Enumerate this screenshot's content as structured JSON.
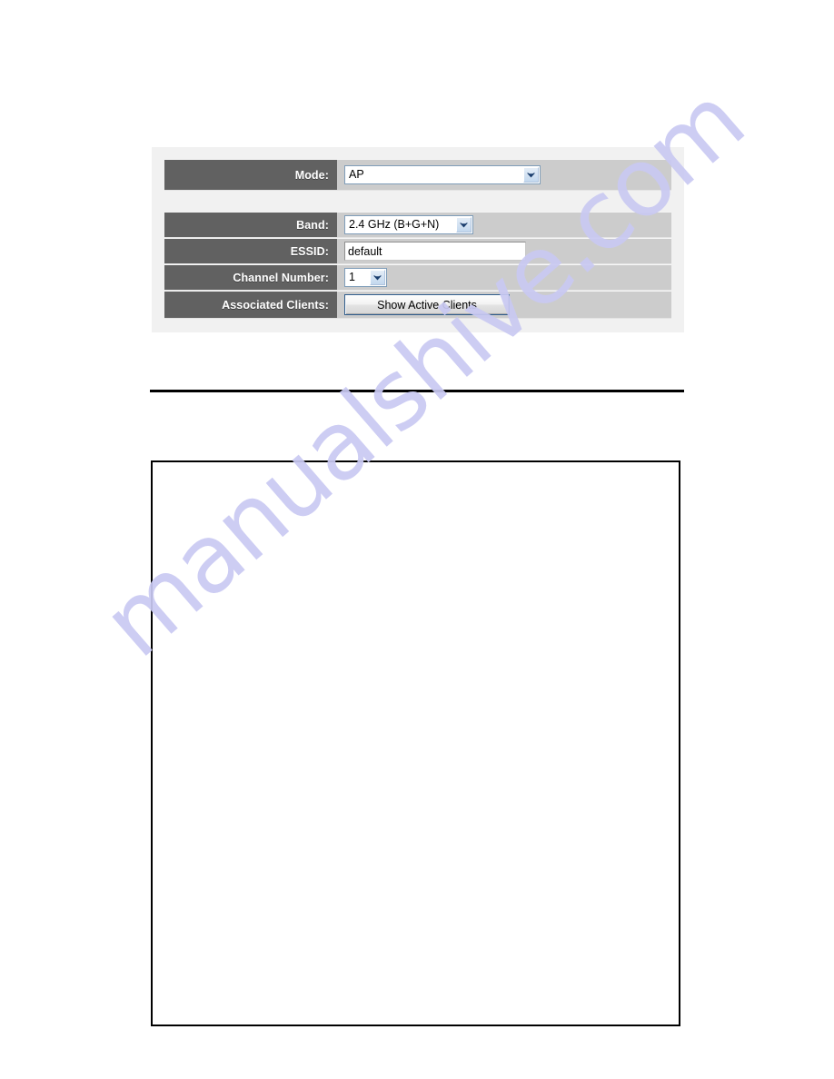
{
  "page": {
    "watermark": "manualshive.com",
    "watermark_color": "#c9c9f2"
  },
  "settings_panel": {
    "label_bg": "#616161",
    "value_bg": "#cccccc",
    "panel_bg": "#f1f1f1",
    "rows": [
      {
        "name": "mode",
        "label": "Mode:",
        "control": "select",
        "value": "AP"
      },
      {
        "name": "band",
        "label": "Band:",
        "control": "select",
        "value": "2.4 GHz (B+G+N)"
      },
      {
        "name": "essid",
        "label": "ESSID:",
        "control": "text",
        "value": "default",
        "placeholder": ""
      },
      {
        "name": "channel-number",
        "label": "Channel Number:",
        "control": "select",
        "value": "1"
      },
      {
        "name": "associated-clients",
        "label": "Associated Clients:",
        "control": "button",
        "value": "Show Active Clients"
      }
    ]
  },
  "icons": {
    "dropdown": "chevron-down-icon"
  }
}
